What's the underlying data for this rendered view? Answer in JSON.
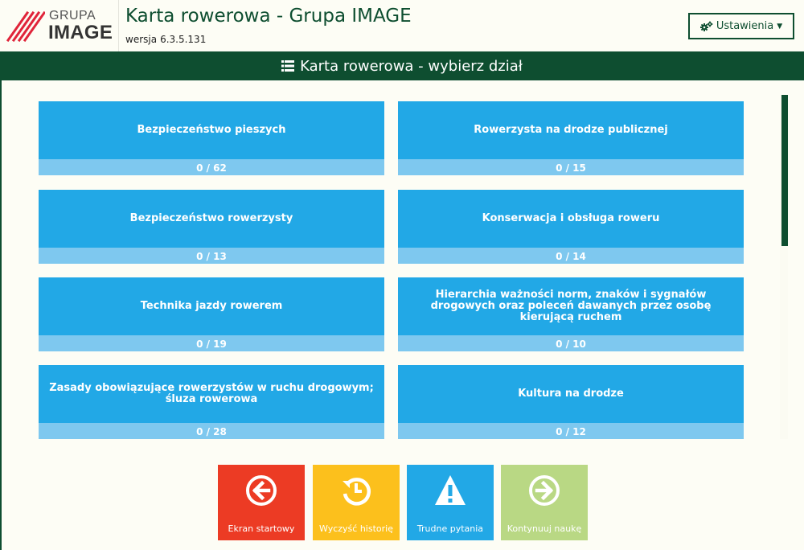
{
  "header": {
    "logo_top": "GRUPA",
    "logo_bottom": "IMAGE",
    "title": "Karta rowerowa - Grupa IMAGE",
    "version_label": "wersja",
    "version": "6.3.5.131",
    "settings_label": "Ustawienia"
  },
  "section": {
    "title": "Karta rowerowa - wybierz dział"
  },
  "categories": [
    {
      "name": "Bezpieczeństwo pieszych",
      "count": "0 / 62",
      "done": 0,
      "total": 62
    },
    {
      "name": "Rowerzysta na drodze publicznej",
      "count": "0 / 15",
      "done": 0,
      "total": 15
    },
    {
      "name": "Bezpieczeństwo rowerzysty",
      "count": "0 / 13",
      "done": 0,
      "total": 13
    },
    {
      "name": "Konserwacja i obsługa roweru",
      "count": "0 / 14",
      "done": 0,
      "total": 14
    },
    {
      "name": "Technika jazdy rowerem",
      "count": "0 / 19",
      "done": 0,
      "total": 19
    },
    {
      "name": "Hierarchia ważności norm, znaków i sygnałów drogowych oraz poleceń dawanych przez osobę kierującą ruchem",
      "count": "0 / 10",
      "done": 0,
      "total": 10
    },
    {
      "name": "Zasady obowiązujące rowerzystów w ruchu drogowym; śluza rowerowa",
      "count": "0 / 28",
      "done": 0,
      "total": 28
    },
    {
      "name": "Kultura na drodze",
      "count": "0 / 12",
      "done": 0,
      "total": 12
    }
  ],
  "actions": [
    {
      "label": "Ekran startowy",
      "icon": "arrow-left-circle-icon",
      "color": "#ec3b24"
    },
    {
      "label": "Wyczyść historię",
      "icon": "history-icon",
      "color": "#fcc01c"
    },
    {
      "label": "Trudne pytania",
      "icon": "warning-icon",
      "color": "#22a8e6"
    },
    {
      "label": "Kontynuuj naukę",
      "icon": "arrow-right-circle-icon",
      "color": "#b9d884"
    }
  ],
  "colors": {
    "brand": "#0e4e30",
    "tile": "#22a8e6",
    "tile_progress": "#7ec8ef",
    "logo_stripes": "#e0243a"
  }
}
